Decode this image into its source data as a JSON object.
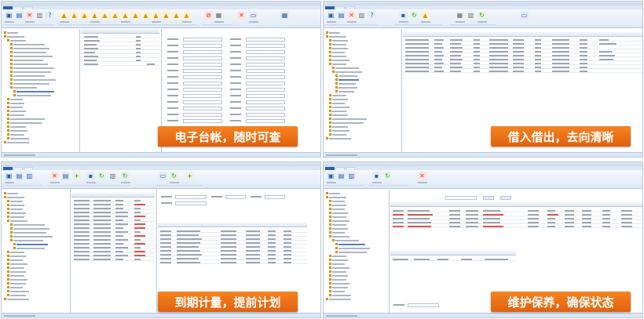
{
  "banners": {
    "ledger": "电子台帐，随时可查",
    "lending": "借入借出，去向清晰",
    "calibration": "到期计量，提前计划",
    "maintenance": "维护保养，确保状态"
  },
  "colors": {
    "banner_orange": "#ee7318",
    "app_blue": "#2b5fa8",
    "ribbon_bg": "#dfe9f5",
    "highlight_red": "#d9352b"
  },
  "icons": {
    "ribbon": [
      "add-icon",
      "delete-icon",
      "save-icon",
      "refresh-icon",
      "warning-icon",
      "print-icon",
      "stop-icon",
      "export-icon"
    ],
    "tree_node": "folder-icon"
  }
}
